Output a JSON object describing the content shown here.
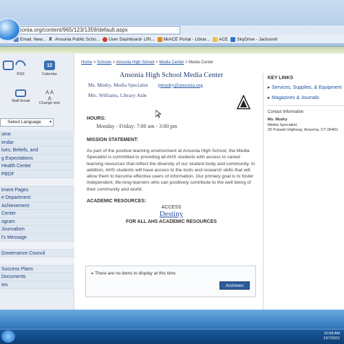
{
  "browser": {
    "url": "ansonia.org/content/965/123/1359/default.aspx",
    "bookmarks": [
      {
        "label": "Email, New...",
        "icon": "page-icon"
      },
      {
        "label": "Ansonia Public Scho...",
        "icon": "x-icon"
      },
      {
        "label": "User Dashboard- LRI...",
        "icon": "circle-icon"
      },
      {
        "label": "MrACE Portal - Librar...",
        "icon": "page-icon"
      },
      {
        "label": "ACE",
        "icon": "folder-icon"
      },
      {
        "label": "SkyDrive - Jacksonll",
        "icon": "cloud-icon"
      }
    ]
  },
  "sidebar": {
    "icons": [
      {
        "label": "",
        "icon": "home-icon"
      },
      {
        "label": "RSS",
        "icon": "rss-icon"
      },
      {
        "label": "Calendar",
        "icon": "calendar-icon",
        "day": "12"
      },
      {
        "label": "",
        "icon": "blank-icon"
      },
      {
        "label": "Staff Email",
        "icon": "mail-icon"
      },
      {
        "label": "Change size",
        "icon": "text-size-icon",
        "glyph": "A A A"
      }
    ],
    "language": "Select Language",
    "nav": [
      "ome",
      "endar",
      "lues, Beliefs, and",
      "g Expectations",
      " Health Center",
      " PBDF",
      "",
      "tment Pages",
      "e Department",
      " Achievement",
      "Center",
      "ogram",
      "Journalism",
      "l's Message",
      "",
      "Governance Council",
      "",
      " Success Plans",
      "Documents",
      "tes"
    ]
  },
  "main": {
    "breadcrumb": {
      "home": "Home",
      "schools": "Schools",
      "school": "Ansonia High School",
      "media": "Media Center",
      "current": "Media Center",
      "sep": ">"
    },
    "title": "Ansonia High School Media Center",
    "staff1": "Ms. Mudry, Media Specialist",
    "staff1_email": "pmudry@ansonia.org",
    "staff2": "Mrs. Williams, Library Aide",
    "hours_heading": "HOURS:",
    "hours": "Monday - Friday: 7:00 am - 3:00 pm",
    "mission_heading": "MISSION STATEMENT:",
    "mission": "As part of the positive learning environment at Ansonia High School, the Media Specialist is committed to providing all AHS students with access to varied learning resources that reflect the diversity of our student body and community. In addition, AHS students will have access to the tools and research skills that will allow them to become effective users of information. Our primary goal is to foster independent, life-long learners who can positively contribute to the well being of their community and world.",
    "academic_heading": "ACADEMIC RESOURCES:",
    "access": "ACCESS",
    "destiny": "Destiny",
    "for_all": "FOR ALL AHS ACADEMIC RESOURCES",
    "news_empty": "There are no items to display at this time",
    "archives": "Archives"
  },
  "right": {
    "key_links_heading": "KEY LINKS",
    "links": [
      "Services, Supplies, & Equipment",
      "Magazines & Journals"
    ],
    "contact_heading": "Contact Information",
    "contact_name": "Ms. Mudry",
    "contact_title": "Media Specialist",
    "contact_addr": "20 Pulaski Highway, Ansonia, CT 06401"
  },
  "taskbar": {
    "clock_time": "10:58 AM",
    "clock_date": "12/7/2011"
  }
}
